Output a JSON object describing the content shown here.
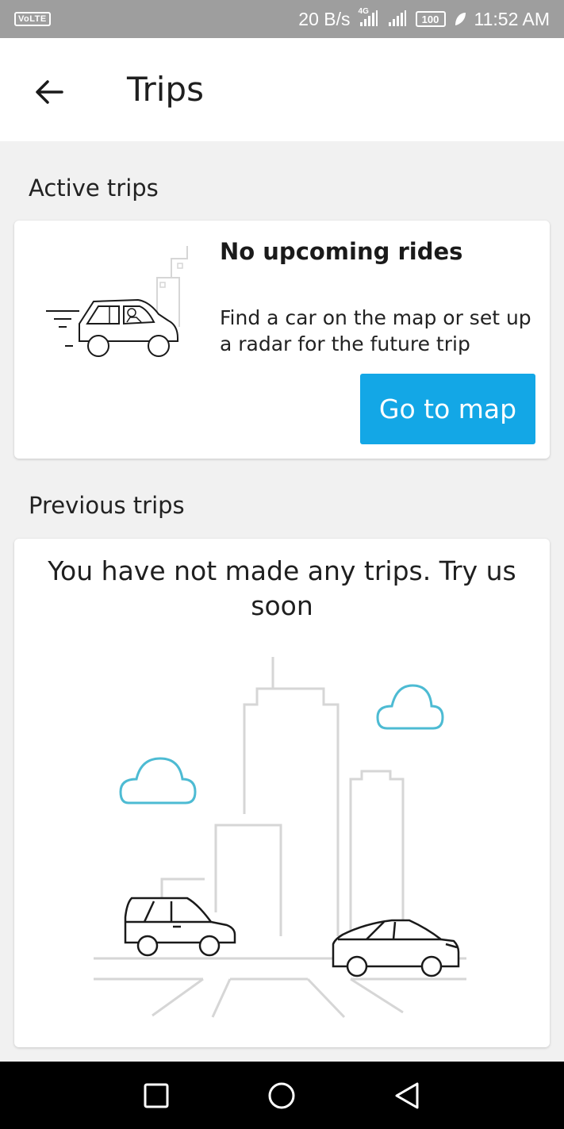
{
  "status_bar": {
    "carrier_badge": "VoLTE",
    "data_speed": "20 B/s",
    "network_label": "4G",
    "battery": "100",
    "time": "11:52 AM"
  },
  "app_bar": {
    "title": "Trips"
  },
  "active_trips": {
    "section_title": "Active trips",
    "empty_title": "No upcoming rides",
    "empty_message": "Find a car on the map or set up a radar for the future trip",
    "button_label": "Go to map"
  },
  "previous_trips": {
    "section_title": "Previous trips",
    "empty_message": "You have not made any trips.  Try us soon"
  },
  "colors": {
    "accent": "#13a7e6",
    "cloud": "#4dbbd3",
    "building": "#d6d6d6",
    "background": "#f1f1f1"
  },
  "icons": {
    "back": "arrow-left-icon",
    "nav_recent": "square-icon",
    "nav_home": "circle-icon",
    "nav_back": "triangle-icon"
  }
}
